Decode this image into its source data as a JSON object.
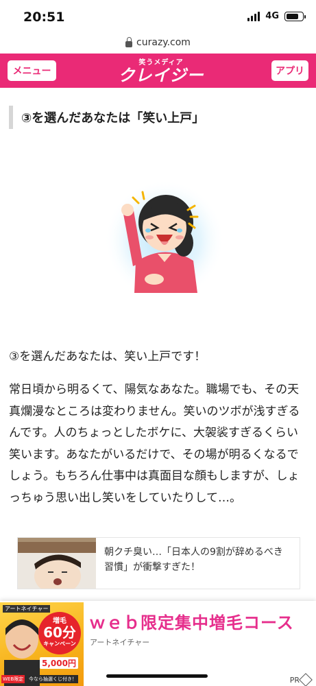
{
  "status_bar": {
    "time": "20:51",
    "network": "4G",
    "battery_percent": 78
  },
  "browser": {
    "url": "curazy.com"
  },
  "header": {
    "menu_label": "メニュー",
    "logo_small": "笑うメディア",
    "logo_main": "クレイジー",
    "app_label": "アプリ",
    "bg_color": "#ea2a76"
  },
  "article": {
    "section_title": "③を選んだあなたは「笑い上戸」",
    "illustration_icon": "laughing-woman-illustration",
    "result_line": "③を選んだあなたは、笑い上戸です！",
    "paragraph": "常日頃から明るくて、陽気なあなた。職場でも、その天真爛漫なところは変わりません。笑いのツボが浅すぎるんです。人のちょっとしたボケに、大袈裟すぎるくらい笑います。あなたがいるだけで、その場が明るくなるでしょう。もちろん仕事中は真面目な顔もしますが、しょっちゅう思い出し笑いをしていたりして…。"
  },
  "related": {
    "title": "朝クチ臭い…「日本人の9割が辞めるべき習慣」が衝撃すぎた！",
    "thumb_icon": "sleeping-man-thumbnail"
  },
  "ad": {
    "brand_tag": "アートネイチャー",
    "circle_top": "増毛",
    "circle_big": "60分",
    "circle_sub": "キャンペーン",
    "price": "5,000円",
    "web_tag": "WEB限定",
    "draw_tag": "今なら抽選くじ付き！",
    "title": "ｗｅｂ限定集中増毛コース",
    "advertiser": "アートネイチャー",
    "pr_label": "PR",
    "accent_color": "#e62e8c"
  }
}
